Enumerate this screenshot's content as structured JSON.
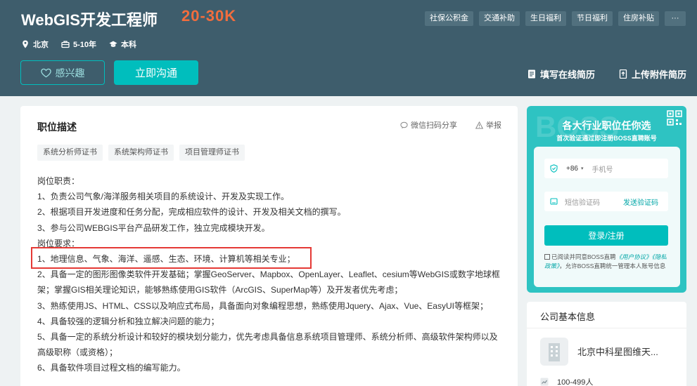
{
  "header": {
    "job_title": "WebGIS开发工程师",
    "salary": "20-30K",
    "location": "北京",
    "experience": "5-10年",
    "education": "本科",
    "benefits": [
      "社保公积金",
      "交通补助",
      "生日福利",
      "节日福利",
      "住房补贴"
    ],
    "more": "···",
    "interest_label": "感兴趣",
    "chat_label": "立即沟通",
    "fill_resume_label": "填写在线简历",
    "upload_resume_label": "上传附件简历"
  },
  "job": {
    "section_title": "职位描述",
    "share_label": "微信扫码分享",
    "report_label": "举报",
    "tags": [
      "系统分析师证书",
      "系统架构师证书",
      "项目管理师证书"
    ],
    "description_lines": [
      "岗位职责：",
      "1、负责公司气象/海洋服务相关项目的系统设计、开发及实现工作。",
      "2、根据项目开发进度和任务分配，完成相应软件的设计、开发及相关文档的撰写。",
      "3、参与公司WEBGIS平台产品研发工作，独立完成模块开发。",
      "岗位要求：",
      "1、地理信息、气象、海洋、遥感、生态、环境、计算机等相关专业；",
      "2、具备一定的图形图像类软件开发基础；掌握GeoServer、Mapbox、OpenLayer、Leaflet、cesium等WebGIS或数字地球框",
      "架；掌握GIS相关理论知识，能够熟练使用GIS软件（ArcGIS、SuperMap等）及开发者优先考虑；",
      "3、熟练使用JS、HTML、CSS以及响应式布局，具备面向对象编程思想，熟练使用Jquery、Ajax、Vue、EasyUI等框架；",
      "4、具备较强的逻辑分析和独立解决问题的能力；",
      "5、具备一定的系统分析设计和较好的模块划分能力，优先考虑具备信息系统项目管理师、系统分析师、高级软件架构师以及",
      "高级职称（或资格）；",
      "6、具备软件项目过程文档的编写能力。"
    ]
  },
  "login": {
    "bg_text": "BOSS",
    "title": "各大行业职位任你选",
    "subtitle": "首次验证通过即注册BOSS直聘账号",
    "country_code": "+86",
    "phone_placeholder": "手机号",
    "code_placeholder": "短信验证码",
    "send_code_label": "发送验证码",
    "login_button": "登录/注册",
    "agree_prefix": "已阅读并同意BOSS直聘",
    "agree_user": "《用户协议》",
    "agree_privacy": "《隐私政策》",
    "agree_suffix": "，允许BOSS直聘统一管理本人账号信息"
  },
  "company": {
    "section_title": "公司基本信息",
    "name": "北京中科星图维天...",
    "size": "100-499人"
  },
  "colors": {
    "header_bg": "#3e5d6c",
    "accent": "#00bebd",
    "salary": "#f26d3d",
    "highlight_box": "#e53935"
  }
}
